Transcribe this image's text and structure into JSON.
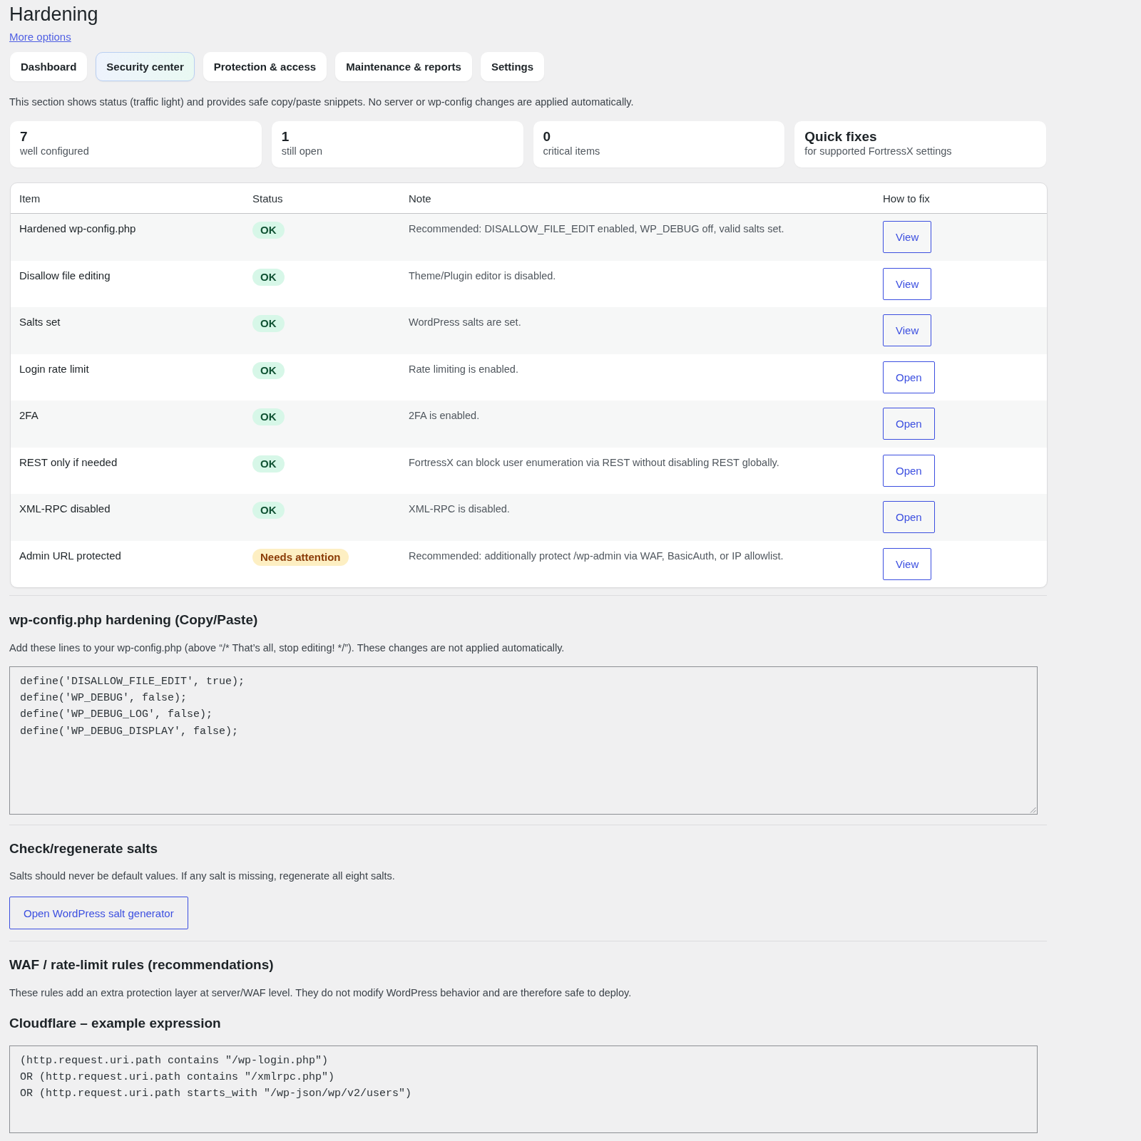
{
  "title": "Hardening",
  "more_options": "More options",
  "tabs": [
    {
      "label": "Dashboard",
      "selected": false
    },
    {
      "label": "Security center",
      "selected": true
    },
    {
      "label": "Protection & access",
      "selected": false
    },
    {
      "label": "Maintenance & reports",
      "selected": false
    },
    {
      "label": "Settings",
      "selected": false
    }
  ],
  "intro": "This section shows status (traffic light) and provides safe copy/paste snippets. No server or wp-config changes are applied automatically.",
  "stats": [
    {
      "value": "7",
      "label": "well configured"
    },
    {
      "value": "1",
      "label": "still open"
    },
    {
      "value": "0",
      "label": "critical items"
    },
    {
      "value": "Quick fixes",
      "label": "for supported FortressX settings"
    }
  ],
  "table": {
    "columns": [
      "Item",
      "Status",
      "Note",
      "How to fix"
    ],
    "rows": [
      {
        "item": "Hardened wp-config.php",
        "status": {
          "kind": "ok",
          "label": "OK"
        },
        "note": "Recommended: DISALLOW_FILE_EDIT enabled, WP_DEBUG off, valid salts set.",
        "action": "View"
      },
      {
        "item": "Disallow file editing",
        "status": {
          "kind": "ok",
          "label": "OK"
        },
        "note": "Theme/Plugin editor is disabled.",
        "action": "View"
      },
      {
        "item": "Salts set",
        "status": {
          "kind": "ok",
          "label": "OK"
        },
        "note": "WordPress salts are set.",
        "action": "View"
      },
      {
        "item": "Login rate limit",
        "status": {
          "kind": "ok",
          "label": "OK"
        },
        "note": "Rate limiting is enabled.",
        "action": "Open"
      },
      {
        "item": "2FA",
        "status": {
          "kind": "ok",
          "label": "OK"
        },
        "note": "2FA is enabled.",
        "action": "Open"
      },
      {
        "item": "REST only if needed",
        "status": {
          "kind": "ok",
          "label": "OK"
        },
        "note": "FortressX can block user enumeration via REST without disabling REST globally.",
        "action": "Open"
      },
      {
        "item": "XML-RPC disabled",
        "status": {
          "kind": "ok",
          "label": "OK"
        },
        "note": "XML-RPC is disabled.",
        "action": "Open"
      },
      {
        "item": "Admin URL protected",
        "status": {
          "kind": "attention",
          "label": "Needs attention"
        },
        "note": "Recommended: additionally protect /wp-admin via WAF, BasicAuth, or IP allowlist.",
        "action": "View"
      }
    ]
  },
  "wp_config": {
    "heading": "wp-config.php hardening (Copy/Paste)",
    "text": "Add these lines to your wp-config.php (above “/* That’s all, stop editing! */”). These changes are not applied automatically.",
    "code": [
      "define('DISALLOW_FILE_EDIT', true);",
      "define('WP_DEBUG', false);",
      "define('WP_DEBUG_LOG', false);",
      "define('WP_DEBUG_DISPLAY', false);"
    ]
  },
  "salts": {
    "heading": "Check/regenerate salts",
    "text": "Salts should never be default values. If any salt is missing, regenerate all eight salts.",
    "button": "Open WordPress salt generator"
  },
  "waf": {
    "heading": "WAF / rate-limit rules (recommendations)",
    "text": "These rules add an extra protection layer at server/WAF level. They do not modify WordPress behavior and are therefore safe to deploy.",
    "subheading": "Cloudflare – example expression",
    "code": [
      "(http.request.uri.path contains \"/wp-login.php\")",
      "OR (http.request.uri.path contains \"/xmlrpc.php\")",
      "OR (http.request.uri.path starts_with \"/wp-json/wp/v2/users\")"
    ]
  }
}
